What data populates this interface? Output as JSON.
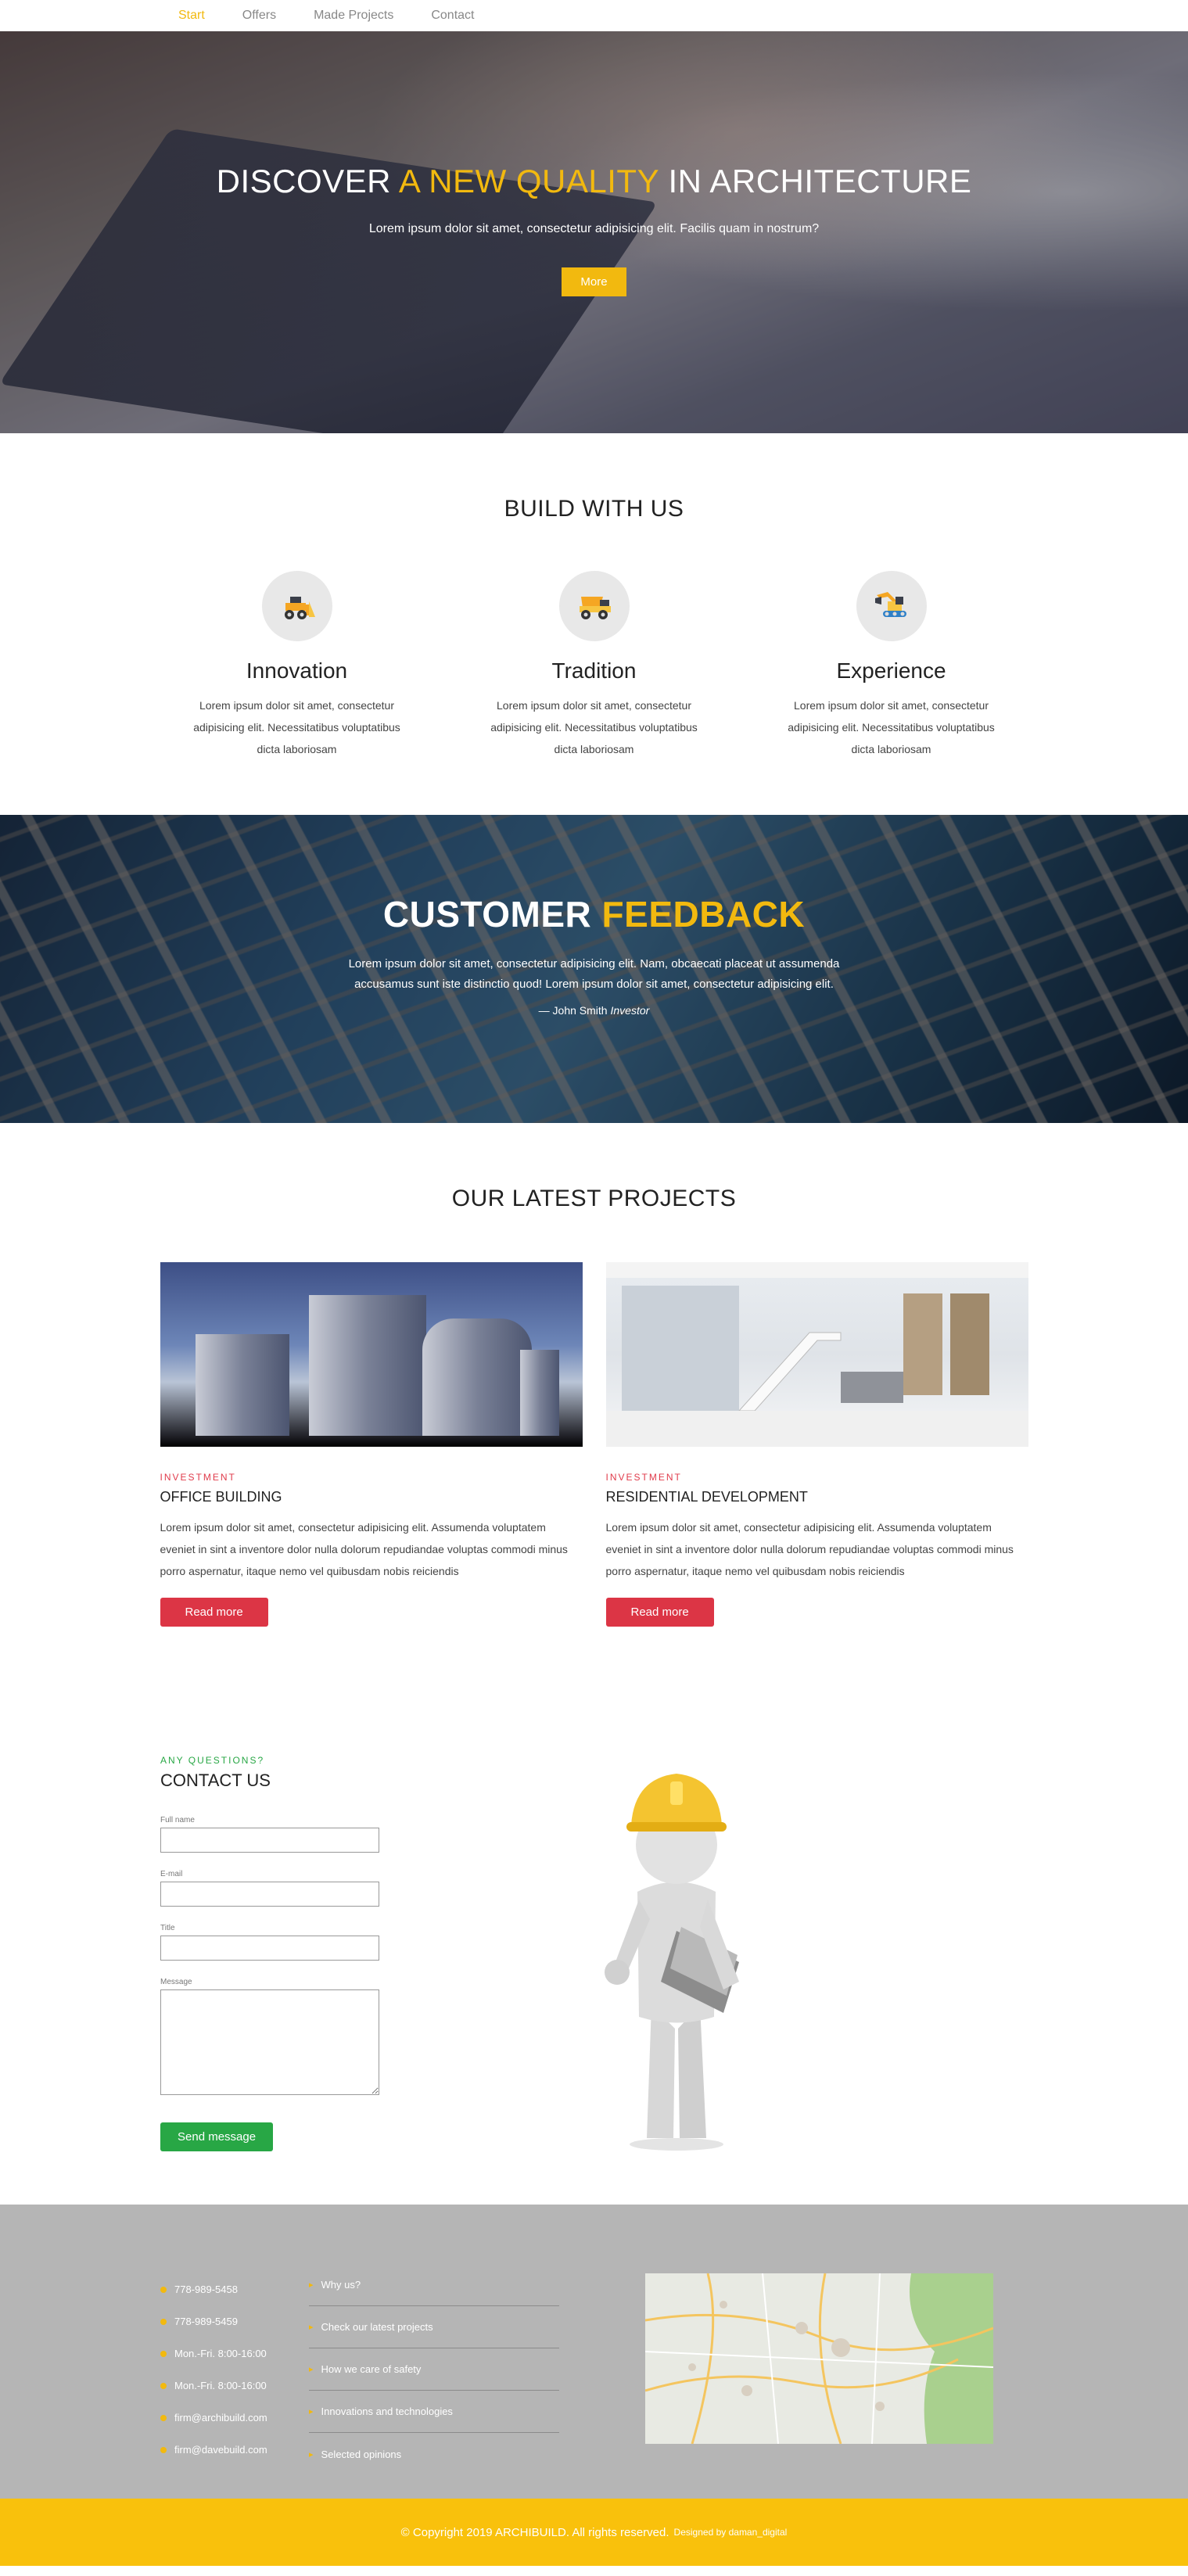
{
  "nav": {
    "items": [
      "Start",
      "Offers",
      "Made Projects",
      "Contact"
    ],
    "active_color": "#f2b90f"
  },
  "hero": {
    "title_pre": "DISCOVER",
    "title_accent": "A NEW QUALITY",
    "title_post": "IN ARCHITECTURE",
    "subtitle": "Lorem ipsum dolor sit amet, consectetur adipisicing elit. Facilis quam in nostrum?",
    "button": "More"
  },
  "build": {
    "title": "BUILD WITH US",
    "features": [
      {
        "icon": "bulldozer-icon",
        "title": "Innovation",
        "text": "Lorem ipsum dolor sit amet, consectetur adipisicing elit. Necessitatibus voluptatibus dicta laboriosam"
      },
      {
        "icon": "dump-truck-icon",
        "title": "Tradition",
        "text": "Lorem ipsum dolor sit amet, consectetur adipisicing elit. Necessitatibus voluptatibus dicta laboriosam"
      },
      {
        "icon": "excavator-icon",
        "title": "Experience",
        "text": "Lorem ipsum dolor sit amet, consectetur adipisicing elit. Necessitatibus voluptatibus dicta laboriosam"
      }
    ]
  },
  "feedback": {
    "title_pre": "CUSTOMER",
    "title_accent": "FEEDBACK",
    "quote": "Lorem ipsum dolor sit amet, consectetur adipisicing elit. Nam, obcaecati placeat ut assumenda accusamus sunt iste distinctio quod! Lorem ipsum dolor sit amet, consectetur adipisicing elit.",
    "author": "— John Smith",
    "role": "Investor"
  },
  "projects": {
    "title": "OUR LATEST PROJECTS",
    "items": [
      {
        "tag": "INVESTMENT",
        "title": "OFFICE BUILDING",
        "text": "Lorem ipsum dolor sit amet, consectetur adipisicing elit. Assumenda voluptatem eveniet in sint a inventore dolor nulla dolorum repudiandae voluptas commodi minus porro aspernatur, itaque nemo vel quibusdam nobis reiciendis",
        "button": "Read more"
      },
      {
        "tag": "INVESTMENT",
        "title": "RESIDENTIAL DEVELOPMENT",
        "text": "Lorem ipsum dolor sit amet, consectetur adipisicing elit. Assumenda voluptatem eveniet in sint a inventore dolor nulla dolorum repudiandae voluptas commodi minus porro aspernatur, itaque nemo vel quibusdam nobis reiciendis",
        "button": "Read more"
      }
    ]
  },
  "contact": {
    "kicker": "ANY QUESTIONS?",
    "title": "CONTACT US",
    "fields": {
      "name": "Full name",
      "email": "E-mail",
      "title": "Title",
      "message": "Message"
    },
    "button": "Send message"
  },
  "footer": {
    "contacts": [
      "778-989-5458",
      "778-989-5459",
      "Mon.-Fri. 8:00-16:00",
      "Mon.-Fri. 8:00-16:00",
      "firm@archibuild.com",
      "firm@davebuild.com"
    ],
    "links": [
      "Why us?",
      "Check our latest projects",
      "How we care of safety",
      "Innovations and technologies",
      "Selected opinions"
    ],
    "copyright": "© Copyright 2019 ARCHIBUILD. All rights reserved.",
    "designed_by": "Designed by daman_digital"
  },
  "colors": {
    "accent": "#f2b90f",
    "danger": "#dc3545",
    "success": "#28a745",
    "footer_bg": "#b5b5b5",
    "copyright_bg": "#f9c10c"
  }
}
